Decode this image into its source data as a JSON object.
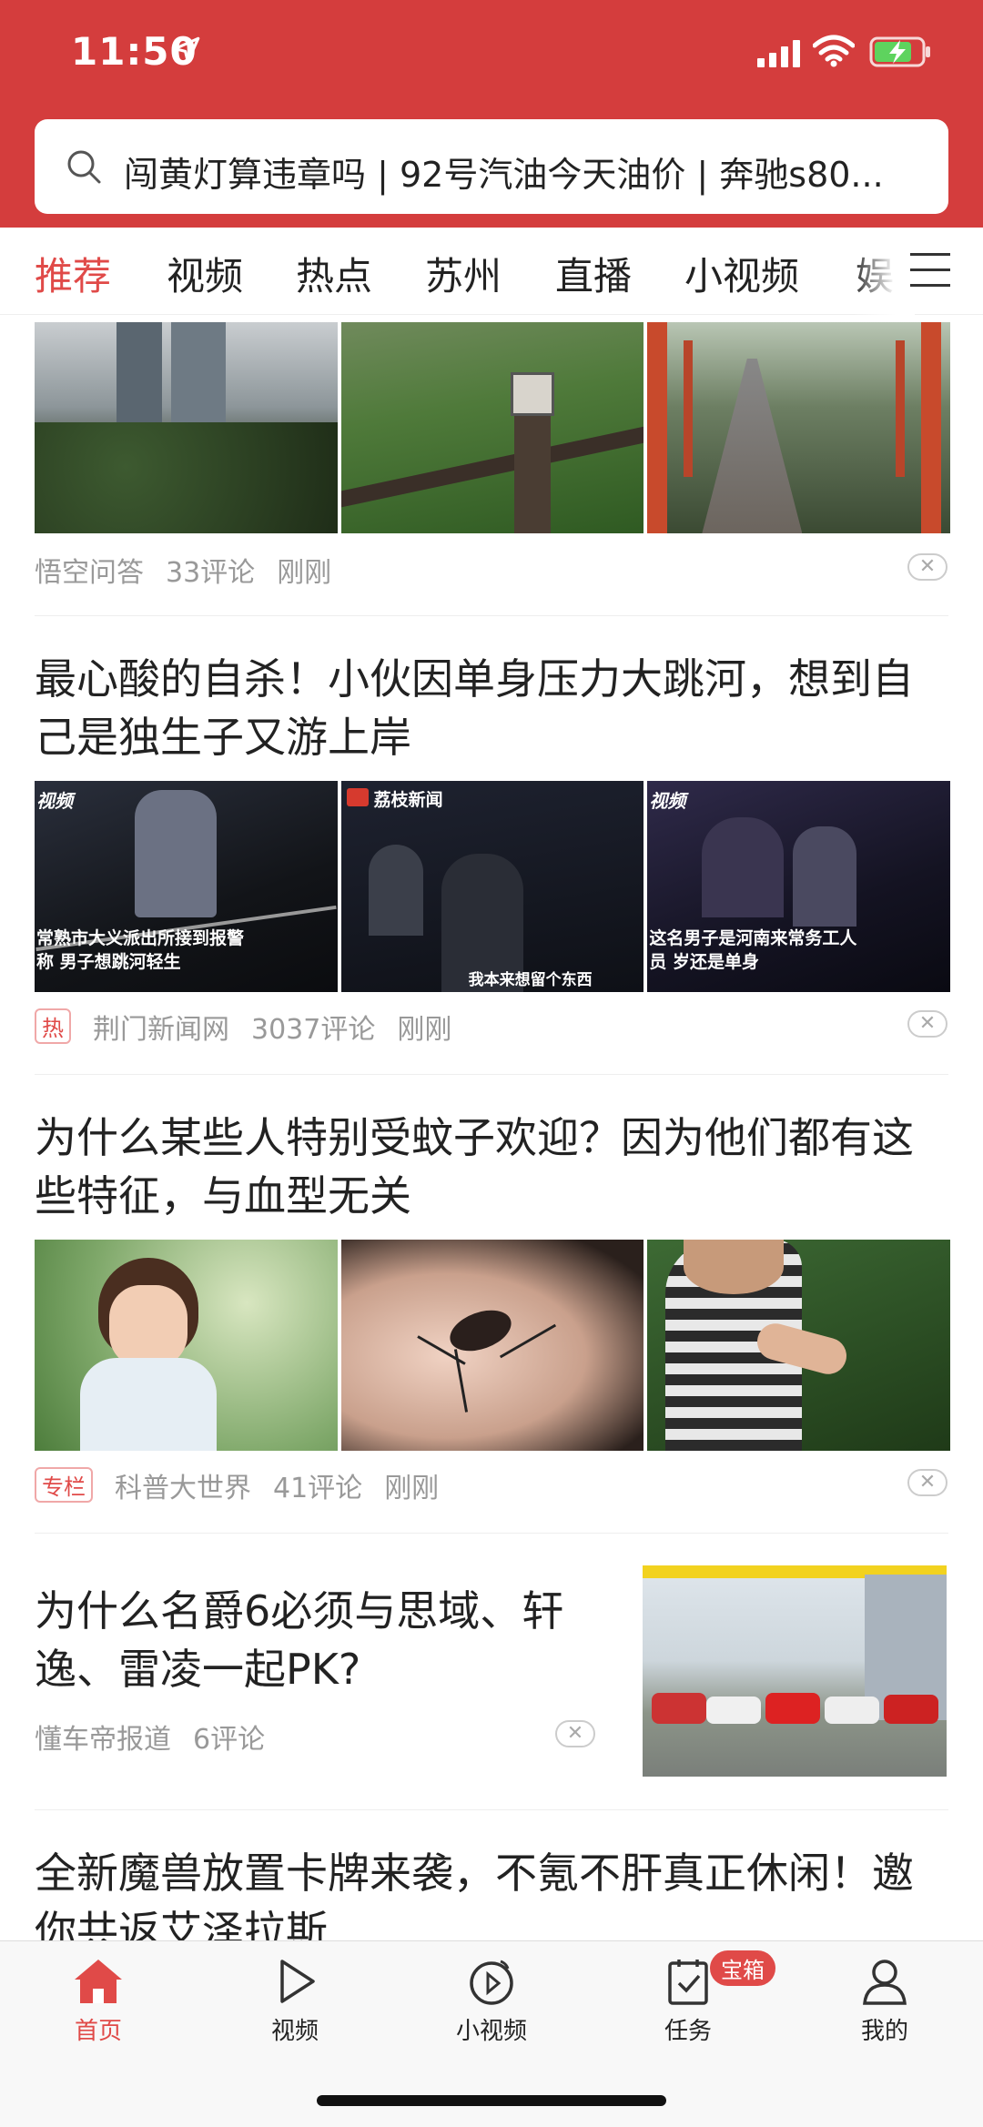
{
  "status_bar": {
    "time": "11:50"
  },
  "search": {
    "query": "闯黄灯算违章吗 | 92号汽油今天油价 | 奔驰s80..."
  },
  "tabs": [
    {
      "label": "推荐"
    },
    {
      "label": "视频"
    },
    {
      "label": "热点"
    },
    {
      "label": "苏州"
    },
    {
      "label": "直播"
    },
    {
      "label": "小视频"
    },
    {
      "label": "娱"
    }
  ],
  "articles": [
    {
      "source": "悟空问答",
      "comments": "33评论",
      "time": "刚刚"
    },
    {
      "title": "最心酸的自杀！小伙因单身压力大跳河，想到自己是独生子又游上岸",
      "tag": "热",
      "source": "荆门新闻网",
      "comments": "3037评论",
      "time": "刚刚",
      "thumb_captions": [
        "视频",
        "荔枝新闻",
        "视频"
      ],
      "thumb_subs": [
        "常熟市大义派出所接到报警称 男子想跳河轻生",
        "我本来想留个东西",
        "这名男子是河南来常务工人员 岁还是单身"
      ]
    },
    {
      "title": "为什么某些人特别受蚊子欢迎？因为他们都有这些特征，与血型无关",
      "tag": "专栏",
      "source": "科普大世界",
      "comments": "41评论",
      "time": "刚刚"
    },
    {
      "title": "为什么名爵6必须与思域、轩逸、雷凌一起PK?",
      "source": "懂车帝报道",
      "comments": "6评论"
    },
    {
      "title": "全新魔兽放置卡牌来袭，不氪不肝真正休闲！邀你共返艾泽拉斯"
    }
  ],
  "close_glyph": "✕",
  "bottom_nav": [
    {
      "label": "首页"
    },
    {
      "label": "视频"
    },
    {
      "label": "小视频"
    },
    {
      "label": "任务",
      "badge": "宝箱"
    },
    {
      "label": "我的"
    }
  ],
  "colors": {
    "brand": "#d43d3d",
    "accent": "#e04a48"
  }
}
